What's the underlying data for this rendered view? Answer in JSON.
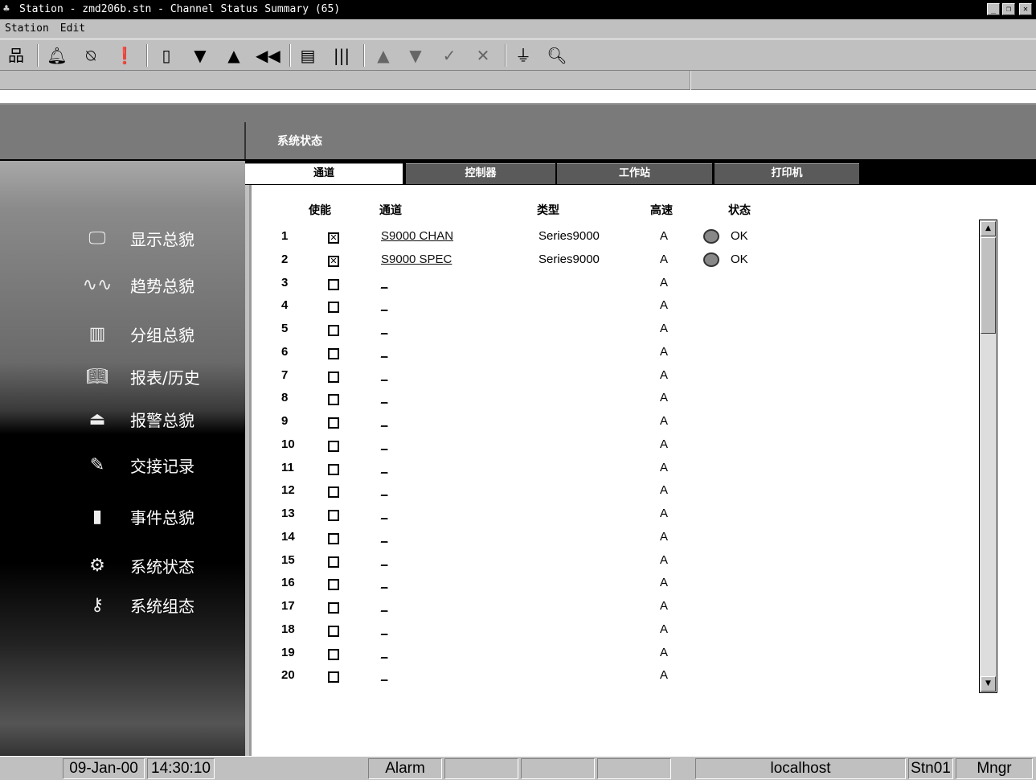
{
  "window": {
    "title": "Station - zmd206b.stn - Channel Status Summary (65)"
  },
  "menu": [
    "Station",
    "Edit"
  ],
  "toolbar": [
    "network-icon",
    "bell-icon",
    "bell-silence-icon",
    "alert-page-icon",
    "blank-page-icon",
    "page-down-icon",
    "page-up-icon",
    "page-back-icon",
    "trend-icon",
    "group-icon",
    "arrow-up-icon",
    "arrow-down-icon",
    "check-icon",
    "x-icon",
    "plug-icon",
    "search-icon"
  ],
  "page_title": "系统状态",
  "tabs": [
    "通道",
    "控制器",
    "工作站",
    "打印机"
  ],
  "sidebar": [
    "显示总貌",
    "趋势总貌",
    "分组总貌",
    "报表/历史",
    "报警总貌",
    "交接记录",
    "事件总貌",
    "系统状态",
    "系统组态"
  ],
  "columns": {
    "enable": "使能",
    "channel": "通道",
    "type": "类型",
    "highspeed": "高速",
    "status": "状态"
  },
  "rows": [
    {
      "n": "1",
      "enabled": true,
      "channel": "S9000 CHAN",
      "type": "Series9000",
      "hs": "A",
      "status": "OK"
    },
    {
      "n": "2",
      "enabled": true,
      "channel": "S9000 SPEC",
      "type": "Series9000",
      "hs": "A",
      "status": "OK"
    },
    {
      "n": "3",
      "enabled": false,
      "channel": "_",
      "type": "",
      "hs": "A",
      "status": ""
    },
    {
      "n": "4",
      "enabled": false,
      "channel": "_",
      "type": "",
      "hs": "A",
      "status": ""
    },
    {
      "n": "5",
      "enabled": false,
      "channel": "_",
      "type": "",
      "hs": "A",
      "status": ""
    },
    {
      "n": "6",
      "enabled": false,
      "channel": "_",
      "type": "",
      "hs": "A",
      "status": ""
    },
    {
      "n": "7",
      "enabled": false,
      "channel": "_",
      "type": "",
      "hs": "A",
      "status": ""
    },
    {
      "n": "8",
      "enabled": false,
      "channel": "_",
      "type": "",
      "hs": "A",
      "status": ""
    },
    {
      "n": "9",
      "enabled": false,
      "channel": "_",
      "type": "",
      "hs": "A",
      "status": ""
    },
    {
      "n": "10",
      "enabled": false,
      "channel": "_",
      "type": "",
      "hs": "A",
      "status": ""
    },
    {
      "n": "11",
      "enabled": false,
      "channel": "_",
      "type": "",
      "hs": "A",
      "status": ""
    },
    {
      "n": "12",
      "enabled": false,
      "channel": "_",
      "type": "",
      "hs": "A",
      "status": ""
    },
    {
      "n": "13",
      "enabled": false,
      "channel": "_",
      "type": "",
      "hs": "A",
      "status": ""
    },
    {
      "n": "14",
      "enabled": false,
      "channel": "_",
      "type": "",
      "hs": "A",
      "status": ""
    },
    {
      "n": "15",
      "enabled": false,
      "channel": "_",
      "type": "",
      "hs": "A",
      "status": ""
    },
    {
      "n": "16",
      "enabled": false,
      "channel": "_",
      "type": "",
      "hs": "A",
      "status": ""
    },
    {
      "n": "17",
      "enabled": false,
      "channel": "_",
      "type": "",
      "hs": "A",
      "status": ""
    },
    {
      "n": "18",
      "enabled": false,
      "channel": "_",
      "type": "",
      "hs": "A",
      "status": ""
    },
    {
      "n": "19",
      "enabled": false,
      "channel": "_",
      "type": "",
      "hs": "A",
      "status": ""
    },
    {
      "n": "20",
      "enabled": false,
      "channel": "_",
      "type": "",
      "hs": "A",
      "status": ""
    }
  ],
  "statusbar": {
    "date": "09-Jan-00",
    "time": "14:30:10",
    "alarm": "Alarm",
    "host": "localhost",
    "station": "Stn01",
    "user": "Mngr"
  }
}
